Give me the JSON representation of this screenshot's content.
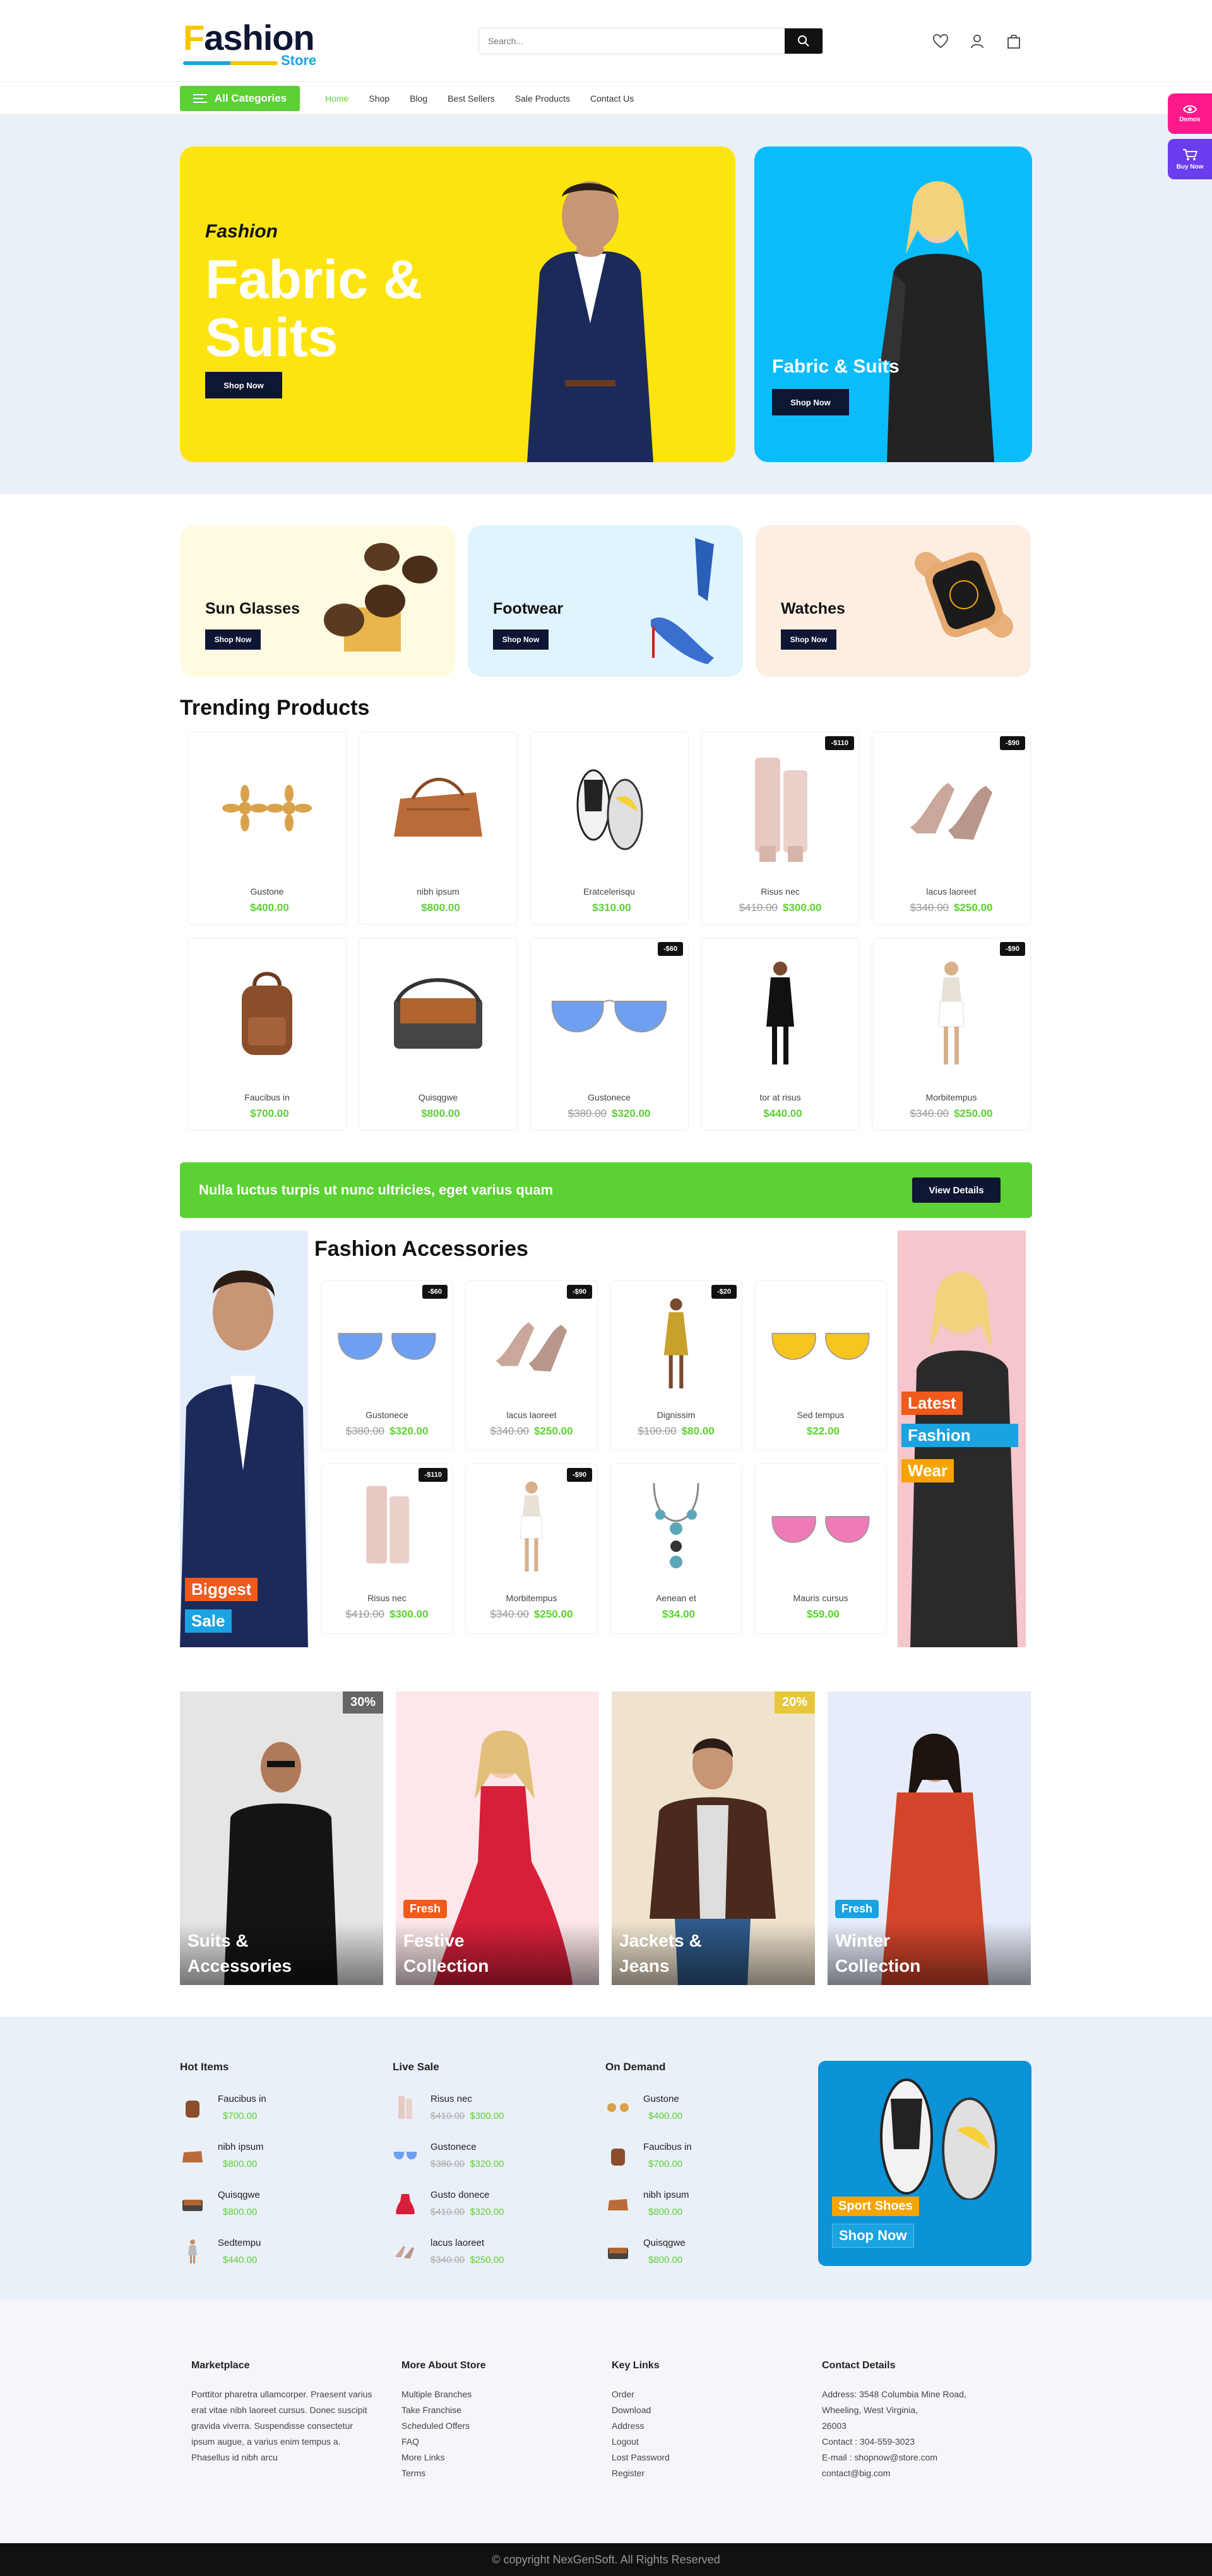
{
  "header": {
    "logo_main": "ashion",
    "logo_first": "F",
    "logo_sub": "Store",
    "search_placeholder": "Search..."
  },
  "nav": {
    "all_categories": "All Categories",
    "items": [
      "Home",
      "Shop",
      "Blog",
      "Best Sellers",
      "Sale Products",
      "Contact Us"
    ]
  },
  "side_tabs": {
    "demos": "Demos",
    "buy_now": "Buy Now"
  },
  "hero": {
    "main_sub": "Fashion",
    "main_title": "Fabric & Suits",
    "main_button": "Shop Now",
    "side_title": "Fabric & Suits",
    "side_button": "Shop Now"
  },
  "promos": [
    {
      "title": "Sun Glasses",
      "button": "Shop Now"
    },
    {
      "title": "Footwear",
      "button": "Shop Now"
    },
    {
      "title": "Watches",
      "button": "Shop Now"
    }
  ],
  "trending": {
    "title": "Trending Products",
    "products": [
      {
        "name": "Gustone",
        "price": "$400.00",
        "old": "",
        "badge": ""
      },
      {
        "name": "nibh ipsum",
        "price": "$800.00",
        "old": "",
        "badge": ""
      },
      {
        "name": "Eratcelerisqu",
        "price": "$310.00",
        "old": "",
        "badge": ""
      },
      {
        "name": "Risus nec",
        "price": "$300.00",
        "old": "$410.00",
        "badge": "-$110"
      },
      {
        "name": "lacus laoreet",
        "price": "$250.00",
        "old": "$340.00",
        "badge": "-$90"
      },
      {
        "name": "Faucibus in",
        "price": "$700.00",
        "old": "",
        "badge": ""
      },
      {
        "name": "Quisqgwe",
        "price": "$800.00",
        "old": "",
        "badge": ""
      },
      {
        "name": "Gustonece",
        "price": "$320.00",
        "old": "$380.00",
        "badge": "-$60"
      },
      {
        "name": "tor at risus",
        "price": "$440.00",
        "old": "",
        "badge": ""
      },
      {
        "name": "Morbitempus",
        "price": "$250.00",
        "old": "$340.00",
        "badge": "-$90"
      }
    ]
  },
  "banner": {
    "text": "Nulla luctus turpis ut nunc ultricies, eget varius quam",
    "button": "View Details"
  },
  "accessories": {
    "title": "Fashion Accessories",
    "left_tags": [
      "Biggest",
      "Sale"
    ],
    "right_tags": [
      "Latest",
      "Fashion",
      "Wear"
    ],
    "products": [
      {
        "name": "Gustonece",
        "price": "$320.00",
        "old": "$380.00",
        "badge": "-$60"
      },
      {
        "name": "lacus laoreet",
        "price": "$250.00",
        "old": "$340.00",
        "badge": "-$90"
      },
      {
        "name": "Dignissim",
        "price": "$80.00",
        "old": "$100.00",
        "badge": "-$20"
      },
      {
        "name": "Sed tempus",
        "price": "$22.00",
        "old": "",
        "badge": ""
      },
      {
        "name": "Risus nec",
        "price": "$300.00",
        "old": "$410.00",
        "badge": "-$110"
      },
      {
        "name": "Morbitempus",
        "price": "$250.00",
        "old": "$340.00",
        "badge": "-$90"
      },
      {
        "name": "Aenean et",
        "price": "$34.00",
        "old": "",
        "badge": ""
      },
      {
        "name": "Mauris cursus",
        "price": "$59.00",
        "old": "",
        "badge": ""
      }
    ]
  },
  "collections": [
    {
      "title": "Suits & Accessories",
      "tag": "",
      "pct": "30%"
    },
    {
      "title": "Festive Collection",
      "tag": "Fresh",
      "pct": ""
    },
    {
      "title": "Jackets & Jeans",
      "tag": "",
      "pct": "20%"
    },
    {
      "title": "Winter Collection",
      "tag": "Fresh",
      "pct": ""
    }
  ],
  "lists": [
    {
      "title": "Hot Items",
      "items": [
        {
          "name": "Faucibus in",
          "price": "$700.00",
          "old": ""
        },
        {
          "name": "nibh ipsum",
          "price": "$800.00",
          "old": ""
        },
        {
          "name": "Quisqgwe",
          "price": "$800.00",
          "old": ""
        },
        {
          "name": "Sedtempu",
          "price": "$440.00",
          "old": ""
        }
      ]
    },
    {
      "title": "Live Sale",
      "items": [
        {
          "name": "Risus nec",
          "price": "$300.00",
          "old": "$410.00"
        },
        {
          "name": "Gustonece",
          "price": "$320.00",
          "old": "$380.00"
        },
        {
          "name": "Gusto donece",
          "price": "$320.00",
          "old": "$410.00"
        },
        {
          "name": "lacus laoreet",
          "price": "$250.00",
          "old": "$340.00"
        }
      ]
    },
    {
      "title": "On Demand",
      "items": [
        {
          "name": "Gustone",
          "price": "$400.00",
          "old": ""
        },
        {
          "name": "Faucibus in",
          "price": "$700.00",
          "old": ""
        },
        {
          "name": "nibh ipsum",
          "price": "$800.00",
          "old": ""
        },
        {
          "name": "Quisqgwe",
          "price": "$800.00",
          "old": ""
        }
      ]
    }
  ],
  "shoes_banner": {
    "tag": "Sport Shoes",
    "button": "Shop Now"
  },
  "footer": {
    "marketplace_title": "Marketplace",
    "marketplace_text": "Porttitor pharetra ullamcorper. Praesent varius erat vitae nibh laoreet cursus. Donec suscipit gravida viverra. Suspendisse consectetur ipsum augue, a varius enim tempus a. Phasellus id nibh arcu",
    "more_title": "More About Store",
    "more_links": [
      "Multiple Branches",
      "Take Franchise",
      "Scheduled Offers",
      "FAQ",
      "More Links",
      "Terms"
    ],
    "key_title": "Key Links",
    "key_links": [
      "Order",
      "Download",
      "Address",
      "Logout",
      "Lost Password",
      "Register"
    ],
    "contact_title": "Contact Details",
    "contact_lines": [
      "Address: 3548 Columbia Mine Road,",
      "Wheeling, West Virginia,",
      "26003",
      "Contact : 304-559-3023",
      "E-mail : shopnow@store.com",
      "contact@big.com"
    ]
  },
  "copyright": "© copyright NexGenSoft. All Rights Reserved",
  "colors": {
    "green": "#5cd133",
    "navy": "#0f1633",
    "yellow": "#fde40f",
    "cyan": "#0abdfa",
    "magenta": "#ff1a8c",
    "violet": "#6a3df0"
  }
}
